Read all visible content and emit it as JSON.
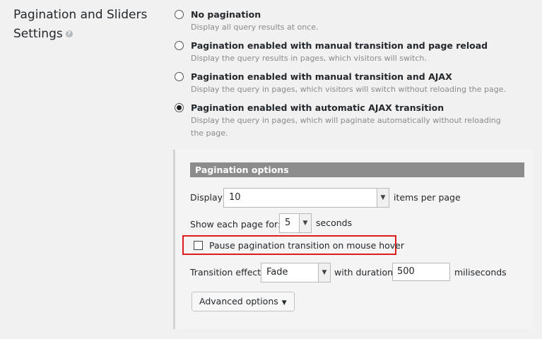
{
  "section": {
    "title": "Pagination and Sliders Settings",
    "help_icon": "question-icon"
  },
  "pagination_modes": [
    {
      "label": "No pagination",
      "description": "Display all query results at once.",
      "checked": false
    },
    {
      "label": "Pagination enabled with manual transition and page reload",
      "description": "Display the query results in pages, which visitors will switch.",
      "checked": false
    },
    {
      "label": "Pagination enabled with manual transition and AJAX",
      "description": "Display the query in pages, which visitors will switch without reloading the page.",
      "checked": false
    },
    {
      "label": "Pagination enabled with automatic AJAX transition",
      "description": "Display the query in pages, which will paginate automatically without reloading the page.",
      "checked": true
    }
  ],
  "options": {
    "header": "Pagination options",
    "display_label": "Display",
    "display_value": "10",
    "display_suffix": "items per page",
    "show_each_label": "Show each page for:",
    "show_each_value": "5",
    "show_each_suffix": "seconds",
    "pause_label": "Pause pagination transition on mouse hover",
    "pause_checked": false,
    "effect_label": "Transition effect:",
    "effect_value": "Fade",
    "duration_label": "with duration",
    "duration_value": "500",
    "duration_suffix": "miliseconds",
    "advanced_button": "Advanced options",
    "highlight_color": "#e01b1b"
  }
}
